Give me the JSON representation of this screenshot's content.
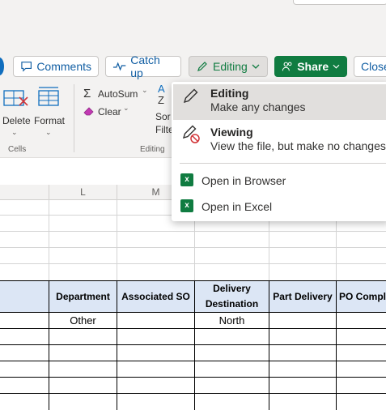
{
  "toolbar": {
    "comments": "Comments",
    "catch_up": "Catch up",
    "editing": "Editing",
    "share": "Share",
    "close": "Close"
  },
  "ribbon": {
    "delete": "Delete",
    "format": "Format",
    "cells_group": "Cells",
    "autosum": "AutoSum",
    "clear": "Clear",
    "sort_filter_top": "Sor",
    "sort_filter_bottom": "Filte",
    "editing_group": "Editing"
  },
  "mode_menu": {
    "editing_title": "Editing",
    "editing_desc": "Make any changes",
    "viewing_title": "Viewing",
    "viewing_desc": "View the file, but make no changes",
    "open_browser": "Open in Browser",
    "open_excel": "Open in Excel"
  },
  "sheet": {
    "col_L": "L",
    "col_M": "M",
    "headers": {
      "department": "Department",
      "associated_so": "Associated SO",
      "delivery_1": "Delivery",
      "delivery_2": "Destination",
      "part_delivery": "Part Delivery",
      "po_compl": "PO Compl"
    },
    "row1": {
      "department": "Other",
      "delivery": "North"
    }
  },
  "colors": {
    "share_green": "#107c41",
    "accent_blue": "#115ea3",
    "header_fill": "#dce6f5"
  }
}
